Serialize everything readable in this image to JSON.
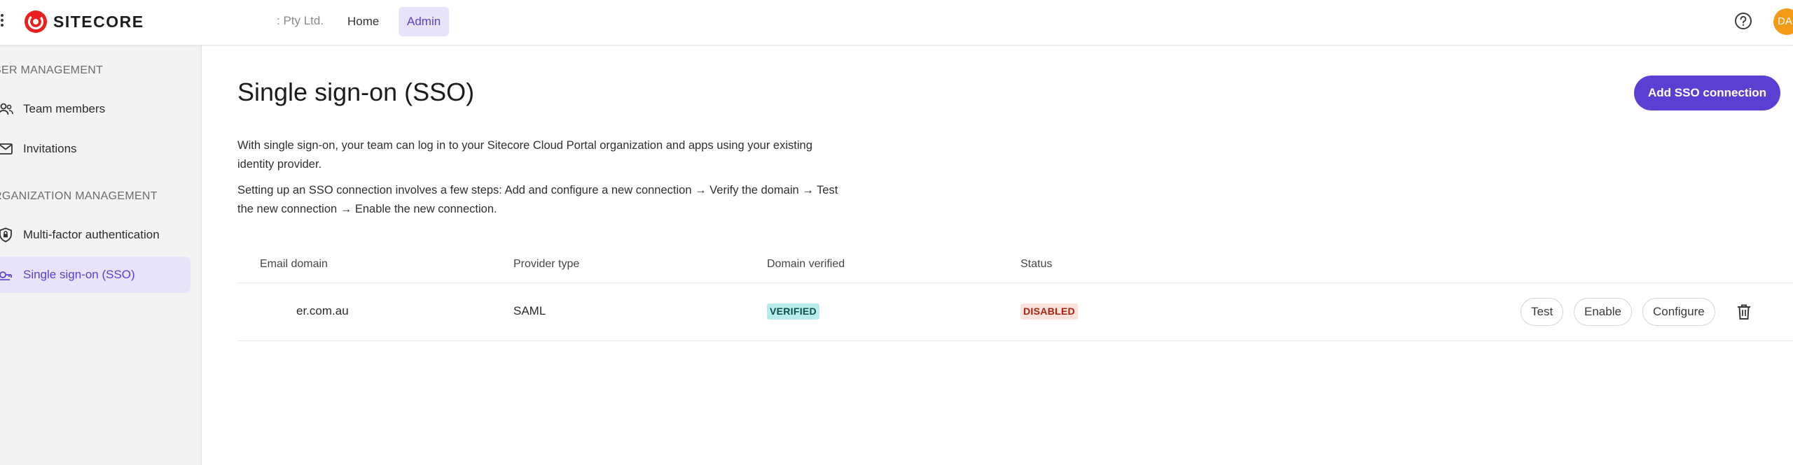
{
  "header": {
    "logo_text": "SITECORE",
    "org_name": ": Pty Ltd.",
    "nav": [
      {
        "label": "Home"
      },
      {
        "label": "Admin"
      }
    ],
    "avatar_initials": "DA",
    "icons": {
      "apps": "grid-dots-icon",
      "help": "help-circle-icon"
    }
  },
  "sidebar": {
    "sections": [
      {
        "label": "SER MANAGEMENT"
      },
      {
        "label": "RGANIZATION MANAGEMENT"
      }
    ],
    "items": [
      {
        "label": "Team members",
        "icon": "people-icon"
      },
      {
        "label": "Invitations",
        "icon": "envelope-icon"
      },
      {
        "label": "Multi-factor authentication",
        "icon": "shield-lock-icon"
      },
      {
        "label": "Single sign-on (SSO)",
        "icon": "key-cloud-icon",
        "active": true
      }
    ]
  },
  "main": {
    "title": "Single sign-on (SSO)",
    "add_button": "Add SSO connection",
    "description_1": "With single sign-on, your team can log in to your Sitecore Cloud Portal organization and apps using your existing identity provider.",
    "description_2": "Setting up an SSO connection involves a few steps: Add and configure a new connection → Verify the domain → Test the new connection → Enable the new connection.",
    "table": {
      "headers": [
        "Email domain",
        "Provider type",
        "Domain verified",
        "Status"
      ],
      "rows": [
        {
          "email_domain": "er.com.au",
          "provider_type": "SAML",
          "domain_verified": "VERIFIED",
          "status": "DISABLED",
          "actions": [
            "Test",
            "Enable",
            "Configure"
          ]
        }
      ]
    }
  },
  "colors": {
    "accent": "#5b3fd3",
    "accent_light": "#e6e3fb",
    "logo_red": "#eb1f1f",
    "avatar": "#f39a18",
    "verified_bg": "#b8ecec",
    "disabled_bg": "#fbe1dc"
  }
}
